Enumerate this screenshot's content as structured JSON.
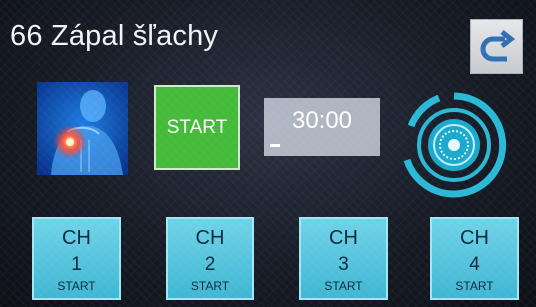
{
  "header": {
    "title": "66 Zápal šľachy"
  },
  "back_button": {
    "icon": "return-arrow-icon"
  },
  "therapy_image": {
    "icon": "shoulder-pain-illustration"
  },
  "main_start": {
    "label": "START",
    "color": "#43bb39"
  },
  "timer": {
    "value": "30:00"
  },
  "dial": {
    "icon": "intensity-dial-icon",
    "color": "#29b9d6"
  },
  "channels": [
    {
      "name": "CH",
      "number": "1",
      "action": "START"
    },
    {
      "name": "CH",
      "number": "2",
      "action": "START"
    },
    {
      "name": "CH",
      "number": "3",
      "action": "START"
    },
    {
      "name": "CH",
      "number": "4",
      "action": "START"
    }
  ],
  "colors": {
    "channel_button": "#4cc2dc",
    "background": "#161b25"
  }
}
